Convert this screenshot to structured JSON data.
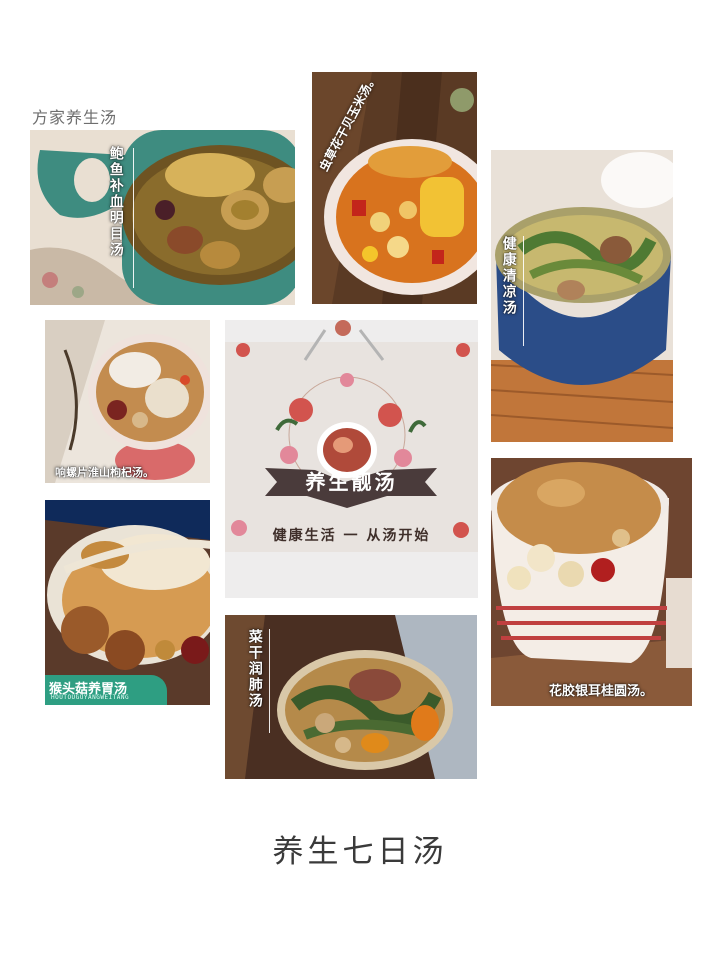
{
  "brand": "方家养生汤",
  "page_title": "养生七日汤",
  "soups": {
    "abalone": "鲍鱼补血明目汤",
    "corn": "虫草花干贝玉米汤。",
    "cooling": "健康清凉汤",
    "whelk": "响螺片淮山枸杞汤。",
    "monkeyhead": "猴头菇养胃汤",
    "monkeyhead_sub": "HOUTOUGUYANGWEITANG",
    "vegetable": "菜干润肺汤",
    "gelatin": "花胶银耳桂圆汤。"
  },
  "card": {
    "banner": "养生靓汤",
    "slogan": "健康生活 一 从汤开始"
  }
}
